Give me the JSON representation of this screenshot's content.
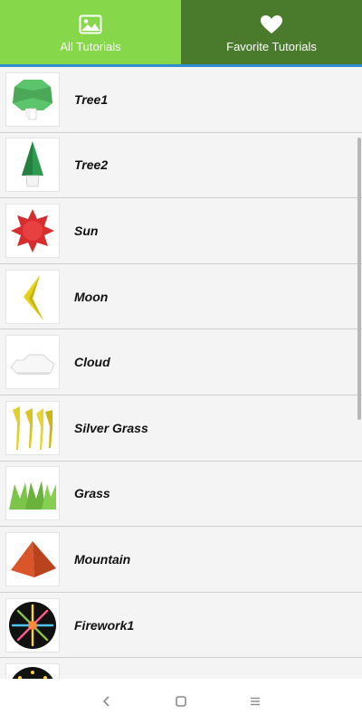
{
  "tabs": {
    "all": {
      "label": "All Tutorials",
      "icon": "image-icon",
      "color": "#86d84a"
    },
    "favorite": {
      "label": "Favorite Tutorials",
      "icon": "heart-icon",
      "color": "#4a7a2c"
    }
  },
  "tutorials": [
    {
      "name": "Tree1",
      "icon": "tree-round-icon"
    },
    {
      "name": "Tree2",
      "icon": "tree-cone-icon"
    },
    {
      "name": "Sun",
      "icon": "sun-icon"
    },
    {
      "name": "Moon",
      "icon": "moon-icon"
    },
    {
      "name": "Cloud",
      "icon": "cloud-icon"
    },
    {
      "name": "Silver Grass",
      "icon": "silver-grass-icon"
    },
    {
      "name": "Grass",
      "icon": "grass-icon"
    },
    {
      "name": "Mountain",
      "icon": "mountain-icon"
    },
    {
      "name": "Firework1",
      "icon": "firework-icon"
    },
    {
      "name": "",
      "icon": "firework-icon"
    }
  ],
  "navbar": {
    "back": "back-icon",
    "home": "home-icon",
    "menu": "menu-icon"
  }
}
